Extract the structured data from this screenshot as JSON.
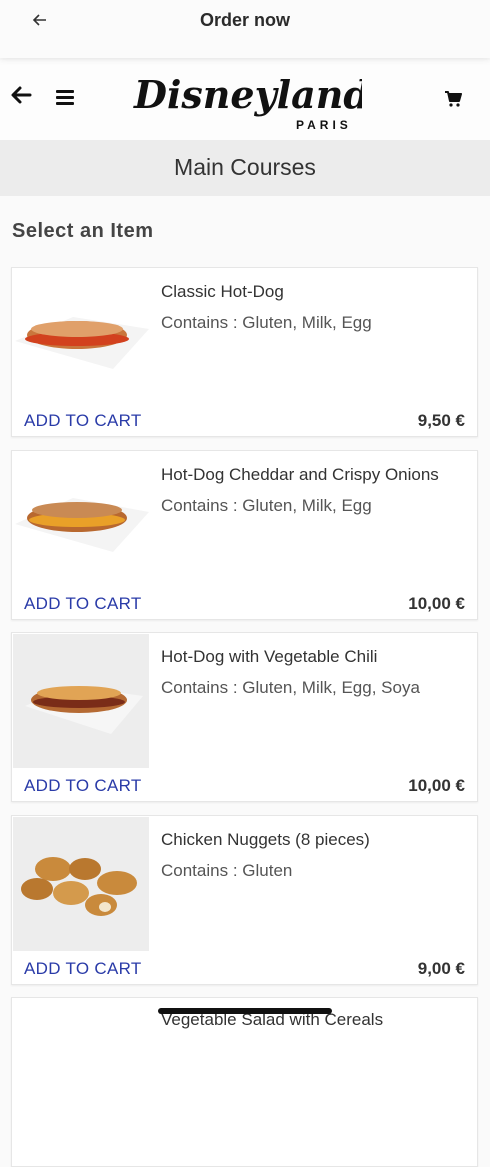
{
  "topbar": {
    "title": "Order now",
    "back_icon": "arrow-left-icon"
  },
  "header": {
    "back_icon": "arrow-left-icon",
    "menu_icon": "hamburger-menu-icon",
    "logo_text": "Disneyland",
    "logo_subtext": "PARIS",
    "cart_icon": "shopping-cart-icon"
  },
  "section": {
    "title": "Main Courses"
  },
  "list": {
    "heading": "Select an Item",
    "items": [
      {
        "name": "Classic Hot-Dog",
        "allergens": "Contains : Gluten, Milk, Egg",
        "add_label": "ADD TO CART",
        "price": "9,50 €",
        "image": "hot-dog-image"
      },
      {
        "name": "Hot-Dog Cheddar and Crispy Onions",
        "allergens": "Contains : Gluten, Milk, Egg",
        "add_label": "ADD TO CART",
        "price": "10,00 €",
        "image": "cheddar-hot-dog-image"
      },
      {
        "name": "Hot-Dog with Vegetable Chili",
        "allergens": "Contains : Gluten, Milk, Egg, Soya",
        "add_label": "ADD TO CART",
        "price": "10,00 €",
        "image": "chili-hot-dog-image"
      },
      {
        "name": "Chicken Nuggets (8 pieces)",
        "allergens": "Contains : Gluten",
        "add_label": "ADD TO CART",
        "price": "9,00 €",
        "image": "chicken-nuggets-image"
      },
      {
        "name": "Vegetable Salad with Cereals",
        "image": "salad-image"
      }
    ]
  },
  "colors": {
    "accent": "#2a3ba8",
    "band": "#ececec",
    "background": "#fafafa"
  }
}
